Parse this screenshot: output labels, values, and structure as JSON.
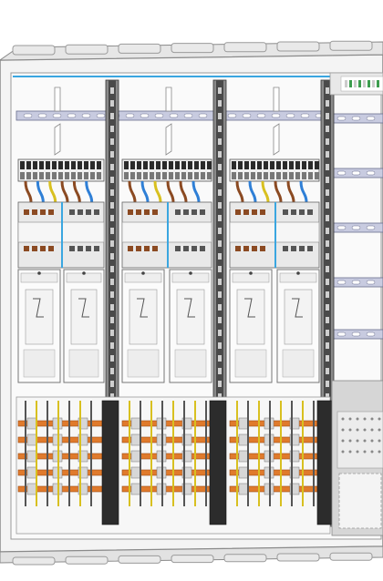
{
  "image": {
    "subject": "electrical-meter-cabinet-interior",
    "colors": {
      "housing": "#f2f2f2",
      "housing_edge": "#9a9a9a",
      "rail": "#c8cbe0",
      "rail_edge": "#6a6e8e",
      "post": "#4a4a4a",
      "busbar": "#e07a2c",
      "busbar_dark": "#9a4a14",
      "wire_brown": "#8b4a22",
      "wire_blue": "#2f7fd6",
      "wire_yellow": "#d8c020",
      "terminal": "#2a2a2a",
      "module": "#e9e9e9",
      "accent_blue": "#3aa6e0",
      "panel_right": "#d6d6d6"
    }
  }
}
